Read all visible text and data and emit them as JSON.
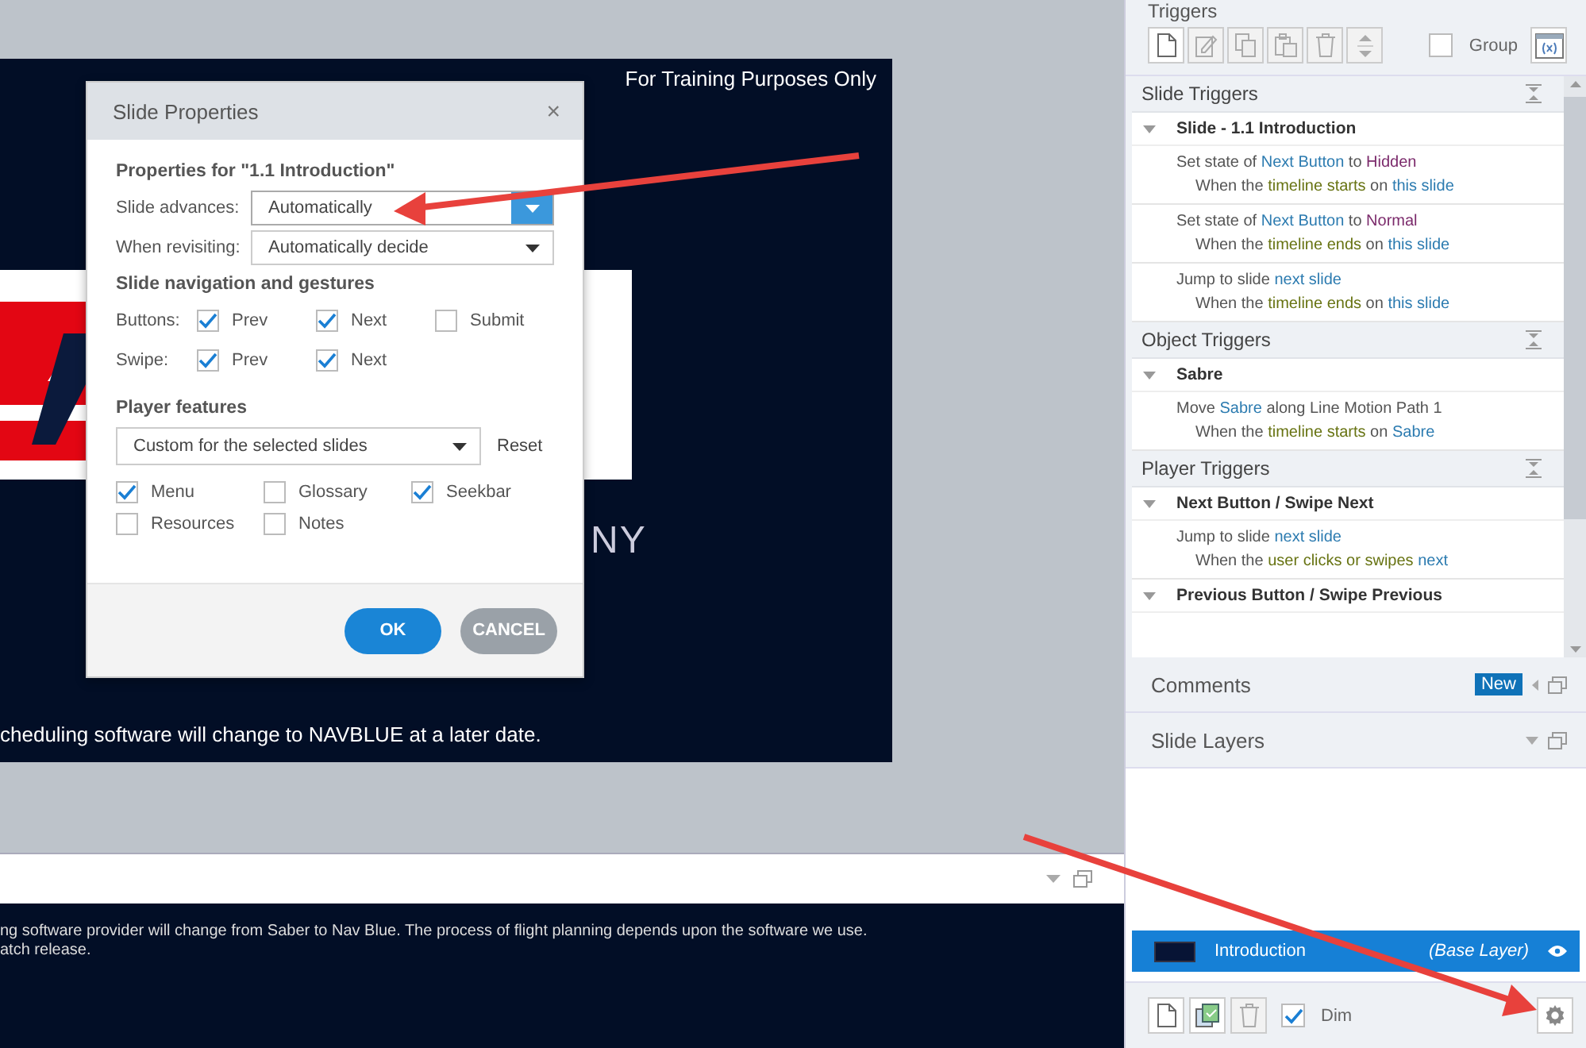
{
  "slide": {
    "badge": "For Training Purposes Only",
    "company_fragment": "NY",
    "caption": "cheduling software will change to NAVBLUE at a later date."
  },
  "dialog": {
    "title": "Slide Properties",
    "close": "×",
    "heading": "Properties for \"1.1 Introduction\"",
    "fields": [
      {
        "label": "Slide advances:",
        "value": "Automatically",
        "focused": true
      },
      {
        "label": "When revisiting:",
        "value": "Automatically decide",
        "focused": false
      }
    ],
    "nav_heading": "Slide navigation and gestures",
    "nav_rows": [
      {
        "label": "Buttons:",
        "options": [
          {
            "label": "Prev",
            "checked": true
          },
          {
            "label": "Next",
            "checked": true
          },
          {
            "label": "Submit",
            "checked": false
          }
        ]
      },
      {
        "label": "Swipe:",
        "options": [
          {
            "label": "Prev",
            "checked": true
          },
          {
            "label": "Next",
            "checked": true
          }
        ]
      }
    ],
    "player_heading": "Player features",
    "player_select": "Custom for the selected slides",
    "reset": "Reset",
    "features": [
      {
        "label": "Menu",
        "checked": true
      },
      {
        "label": "Glossary",
        "checked": false
      },
      {
        "label": "Seekbar",
        "checked": true
      },
      {
        "label": "Resources",
        "checked": false
      },
      {
        "label": "Notes",
        "checked": false
      }
    ],
    "buttons": [
      {
        "label": "OK",
        "kind": "primary"
      },
      {
        "label": "CANCEL",
        "kind": "secondary"
      }
    ]
  },
  "notes": {
    "lines": [
      "ng software provider will change from Saber to Nav Blue.   The process of flight planning depends upon the software we use.",
      "atch release."
    ]
  },
  "triggers_panel": {
    "title": "Triggers",
    "group_label": "Group",
    "group_checked": false,
    "sections": [
      {
        "title": "Slide Triggers",
        "groups": [
          {
            "name": "Slide - 1.1 Introduction",
            "expanded": true,
            "items": [
              {
                "action": [
                  {
                    "text": "Set state of ",
                    "kind": "plain"
                  },
                  {
                    "text": "Next Button",
                    "kind": "object"
                  },
                  {
                    "text": " to ",
                    "kind": "plain"
                  },
                  {
                    "text": "Hidden",
                    "kind": "state"
                  }
                ],
                "condition": [
                  {
                    "text": "When the ",
                    "kind": "plain"
                  },
                  {
                    "text": "timeline starts",
                    "kind": "event"
                  },
                  {
                    "text": " on ",
                    "kind": "plain"
                  },
                  {
                    "text": "this slide",
                    "kind": "object"
                  }
                ]
              },
              {
                "action": [
                  {
                    "text": "Set state of ",
                    "kind": "plain"
                  },
                  {
                    "text": "Next Button",
                    "kind": "object"
                  },
                  {
                    "text": " to ",
                    "kind": "plain"
                  },
                  {
                    "text": "Normal",
                    "kind": "state"
                  }
                ],
                "condition": [
                  {
                    "text": "When the ",
                    "kind": "plain"
                  },
                  {
                    "text": "timeline ends",
                    "kind": "event"
                  },
                  {
                    "text": " on ",
                    "kind": "plain"
                  },
                  {
                    "text": "this slide",
                    "kind": "object"
                  }
                ]
              },
              {
                "action": [
                  {
                    "text": "Jump to slide ",
                    "kind": "plain"
                  },
                  {
                    "text": "next slide",
                    "kind": "object"
                  }
                ],
                "condition": [
                  {
                    "text": "When the ",
                    "kind": "plain"
                  },
                  {
                    "text": "timeline ends",
                    "kind": "event"
                  },
                  {
                    "text": " on ",
                    "kind": "plain"
                  },
                  {
                    "text": "this slide",
                    "kind": "object"
                  }
                ]
              }
            ]
          }
        ]
      },
      {
        "title": "Object Triggers",
        "groups": [
          {
            "name": "Sabre",
            "expanded": true,
            "items": [
              {
                "action": [
                  {
                    "text": "Move ",
                    "kind": "plain"
                  },
                  {
                    "text": "Sabre",
                    "kind": "object"
                  },
                  {
                    "text": " along Line Motion Path 1",
                    "kind": "plain"
                  }
                ],
                "condition": [
                  {
                    "text": "When the ",
                    "kind": "plain"
                  },
                  {
                    "text": "timeline starts",
                    "kind": "event"
                  },
                  {
                    "text": " on ",
                    "kind": "plain"
                  },
                  {
                    "text": "Sabre",
                    "kind": "object"
                  }
                ]
              }
            ]
          }
        ]
      },
      {
        "title": "Player Triggers",
        "groups": [
          {
            "name": "Next Button / Swipe Next",
            "expanded": true,
            "items": [
              {
                "action": [
                  {
                    "text": "Jump to slide ",
                    "kind": "plain"
                  },
                  {
                    "text": "next slide",
                    "kind": "object"
                  }
                ],
                "condition": [
                  {
                    "text": "When the ",
                    "kind": "plain"
                  },
                  {
                    "text": "user clicks or swipes",
                    "kind": "event"
                  },
                  {
                    "text": " next",
                    "kind": "object"
                  }
                ]
              }
            ]
          },
          {
            "name": "Previous Button / Swipe Previous",
            "expanded": true
          }
        ]
      }
    ]
  },
  "comments": {
    "title": "Comments",
    "badge": "New"
  },
  "layers": {
    "title": "Slide Layers",
    "rows": [
      {
        "name": "Introduction",
        "note": "(Base Layer)",
        "selected": true
      }
    ],
    "dim_label": "Dim",
    "dim_checked": true
  }
}
